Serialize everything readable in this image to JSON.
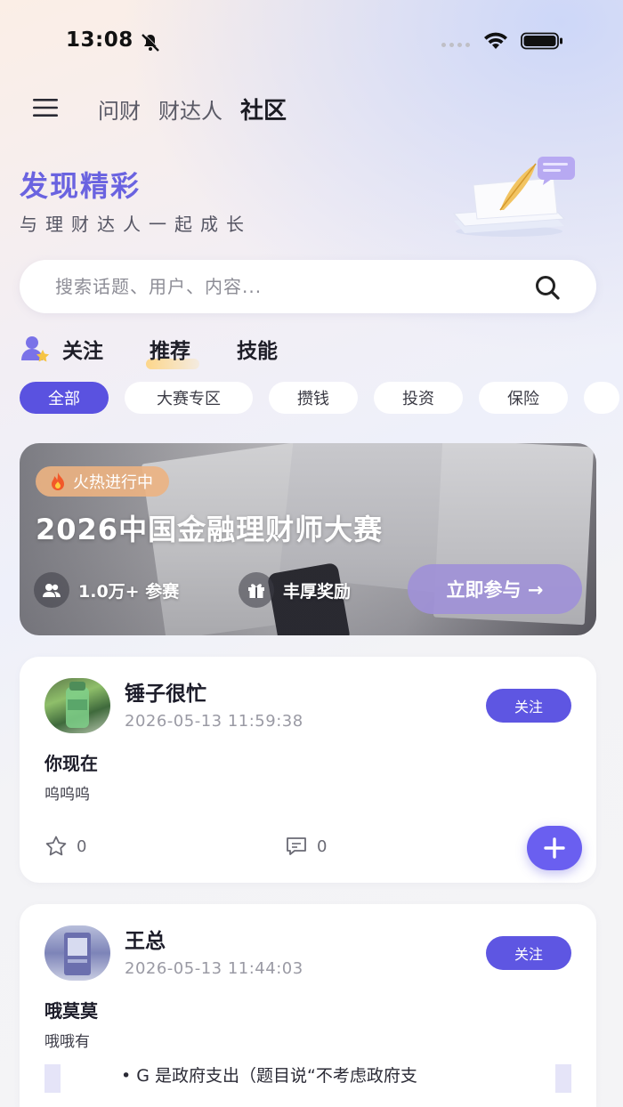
{
  "status_bar": {
    "time": "13:08"
  },
  "top_tabs": [
    {
      "label": "问财",
      "active": false
    },
    {
      "label": "财达人",
      "active": false
    },
    {
      "label": "社区",
      "active": true
    }
  ],
  "hero": {
    "title": "发现精彩",
    "subtitle": "与理财达人一起成长"
  },
  "search": {
    "placeholder": "搜索话题、用户、内容..."
  },
  "feed_tabs": [
    {
      "label": "关注",
      "active": false
    },
    {
      "label": "推荐",
      "active": true
    },
    {
      "label": "技能",
      "active": false
    }
  ],
  "categories": [
    {
      "label": "全部",
      "active": true
    },
    {
      "label": "大赛专区",
      "active": false
    },
    {
      "label": "攒钱",
      "active": false
    },
    {
      "label": "投资",
      "active": false
    },
    {
      "label": "保险",
      "active": false
    }
  ],
  "banner": {
    "badge": "火热进行中",
    "title": "2026中国金融理财师大赛",
    "participants": "1.0万+ 参赛",
    "reward": "丰厚奖励",
    "cta": "立即参与 →"
  },
  "posts": [
    {
      "username": "锤子很忙",
      "time": "2026-05-13 11:59:38",
      "follow_label": "关注",
      "title": "你现在",
      "body": "呜呜呜",
      "likes": "0",
      "comments": "0"
    },
    {
      "username": "王总",
      "time": "2026-05-13 11:44:03",
      "follow_label": "关注",
      "title": "哦莫莫",
      "body": "哦哦有",
      "bullet": "G 是政府支出（题目说“不考虑政府支"
    }
  ],
  "colors": {
    "accent": "#5e56e2",
    "hero_title": "#6a63e0"
  }
}
